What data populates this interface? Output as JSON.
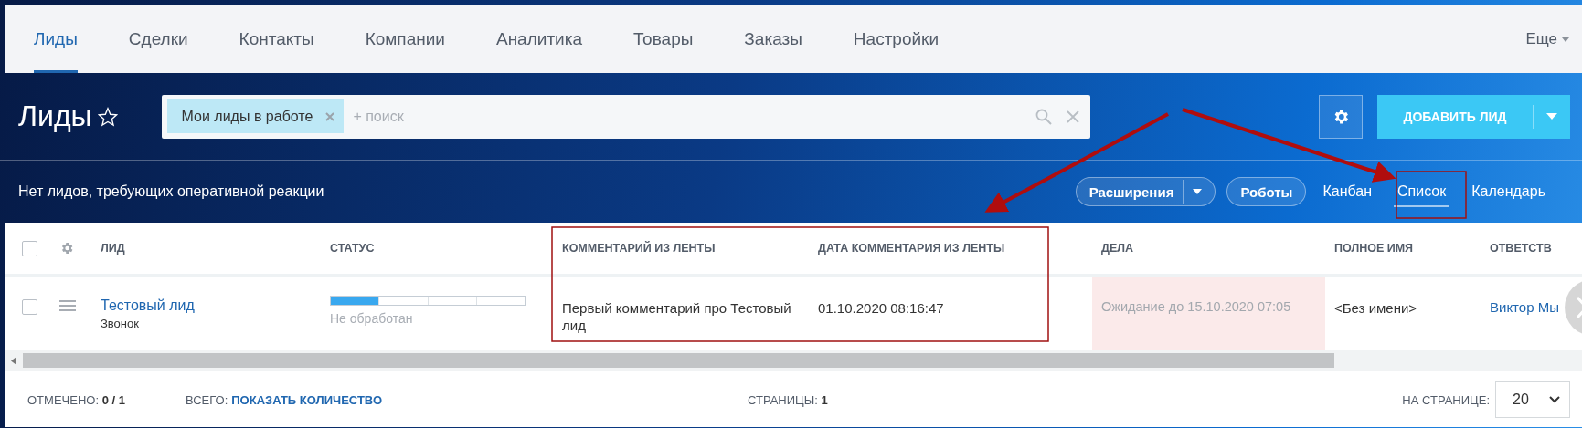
{
  "nav": {
    "items": [
      {
        "label": "Лиды",
        "selected": true
      },
      {
        "label": "Сделки",
        "selected": false
      },
      {
        "label": "Контакты",
        "selected": false
      },
      {
        "label": "Компании",
        "selected": false
      },
      {
        "label": "Аналитика",
        "selected": false
      },
      {
        "label": "Товары",
        "selected": false
      },
      {
        "label": "Заказы",
        "selected": false
      },
      {
        "label": "Настройки",
        "selected": false
      }
    ],
    "more": "Еще"
  },
  "header": {
    "title": "Лиды",
    "filter_chip": "Мои лиды в работе",
    "search_placeholder": "+ поиск",
    "add_button": "ДОБАВИТЬ ЛИД",
    "notice": "Нет лидов, требующих оперативной реакции",
    "extensions_button": "Расширения",
    "robots_button": "Роботы",
    "views": [
      {
        "label": "Канбан",
        "selected": false
      },
      {
        "label": "Список",
        "selected": true
      },
      {
        "label": "Календарь",
        "selected": false
      }
    ]
  },
  "table": {
    "header_checked": false,
    "columns": [
      "ЛИД",
      "СТАТУС",
      "КОММЕНТАРИЙ ИЗ ЛЕНТЫ",
      "ДАТА КОММЕНТАРИЯ ИЗ ЛЕНТЫ",
      "ДЕЛА",
      "ПОЛНОЕ ИМЯ",
      "ОТВЕТСТВ"
    ],
    "rows": [
      {
        "checked": false,
        "lead": "Тестовый лид",
        "source": "Звонок",
        "status": {
          "level": 0.25,
          "label": "Не обработан"
        },
        "comment": "Первый комментарий про Тестовый лид",
        "comment_date": "01.10.2020 08:16:47",
        "activity": "Ожидание до 15.10.2020 07:05",
        "full_name": "<Без имени>",
        "responsible": "Виктор Мы"
      }
    ]
  },
  "footer": {
    "checked_label": "ОТМЕЧЕНО:",
    "checked_value": "0 / 1",
    "total_label": "ВСЕГО:",
    "total_link": "ПОКАЗАТЬ КОЛИЧЕСТВО",
    "pages_label": "СТРАНИЦЫ:",
    "pages_value": "1",
    "per_page_label": "НА СТРАНИЦЕ:",
    "per_page_value": "20"
  }
}
